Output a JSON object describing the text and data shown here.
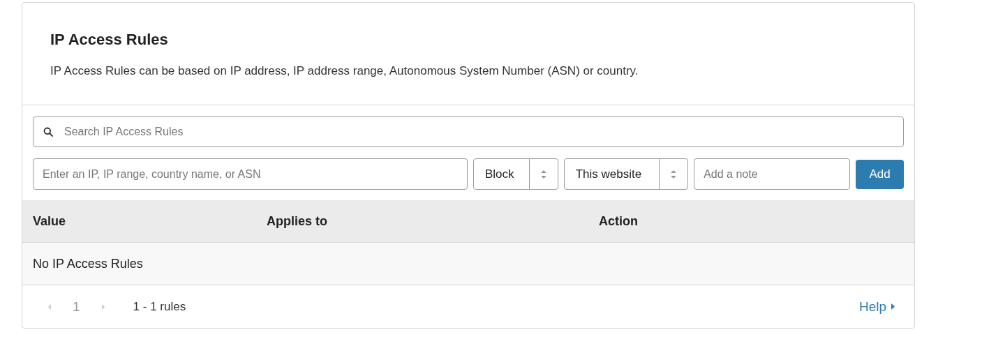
{
  "title": "IP Access Rules",
  "description": "IP Access Rules can be based on IP address, IP address range, Autonomous System Number (ASN) or country.",
  "search": {
    "placeholder": "Search IP Access Rules"
  },
  "form": {
    "value_placeholder": "Enter an IP, IP range, country name, or ASN",
    "action": "Block",
    "scope": "This website",
    "note_placeholder": "Add a note",
    "button": "Add"
  },
  "table": {
    "columns": [
      "Value",
      "Applies to",
      "Action"
    ],
    "empty_text": "No IP Access Rules"
  },
  "pager": {
    "prev": {
      "disabled": true
    },
    "page": "1",
    "next": {
      "disabled": true
    },
    "range": "1 - 1 rules"
  },
  "help": "Help"
}
